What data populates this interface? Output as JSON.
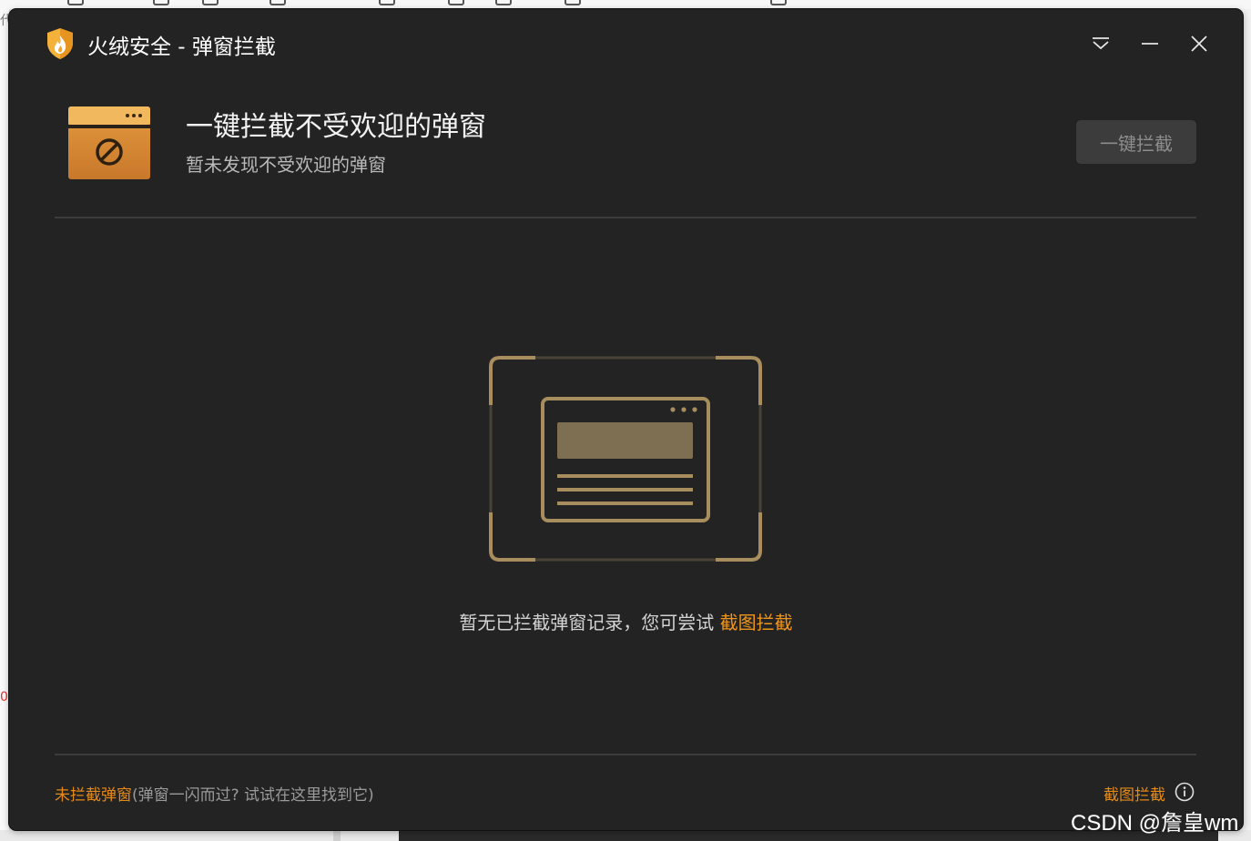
{
  "window": {
    "title": "火绒安全 - 弹窗拦截"
  },
  "header": {
    "title": "一键拦截不受欢迎的弹窗",
    "subtitle": "暂未发现不受欢迎的弹窗",
    "block_button_label": "一键拦截",
    "block_button_enabled": false
  },
  "empty_state": {
    "message": "暂无已拦截弹窗记录，您可尝试 ",
    "link_label": "截图拦截"
  },
  "footer": {
    "left_link": "未拦截弹窗",
    "left_hint": "(弹窗一闪而过? 试试在这里找到它)",
    "right_link": "截图拦截"
  },
  "watermark": "CSDN @詹皇wm",
  "background": {
    "left_glyph_top": "代",
    "left_glyph_mid": "0"
  },
  "colors": {
    "window_bg": "#232323",
    "accent_orange": "#e58a16",
    "illustration_gold": "#a88d5e",
    "button_disabled_bg": "#3c3c3c"
  },
  "icons": {
    "app_logo": "huorong-shield-flame-icon",
    "menu": "chevron-menu-icon",
    "minimize": "minimize-icon",
    "close": "close-icon",
    "header": "popup-block-window-icon",
    "empty": "popup-window-illustration",
    "info": "info-icon"
  }
}
